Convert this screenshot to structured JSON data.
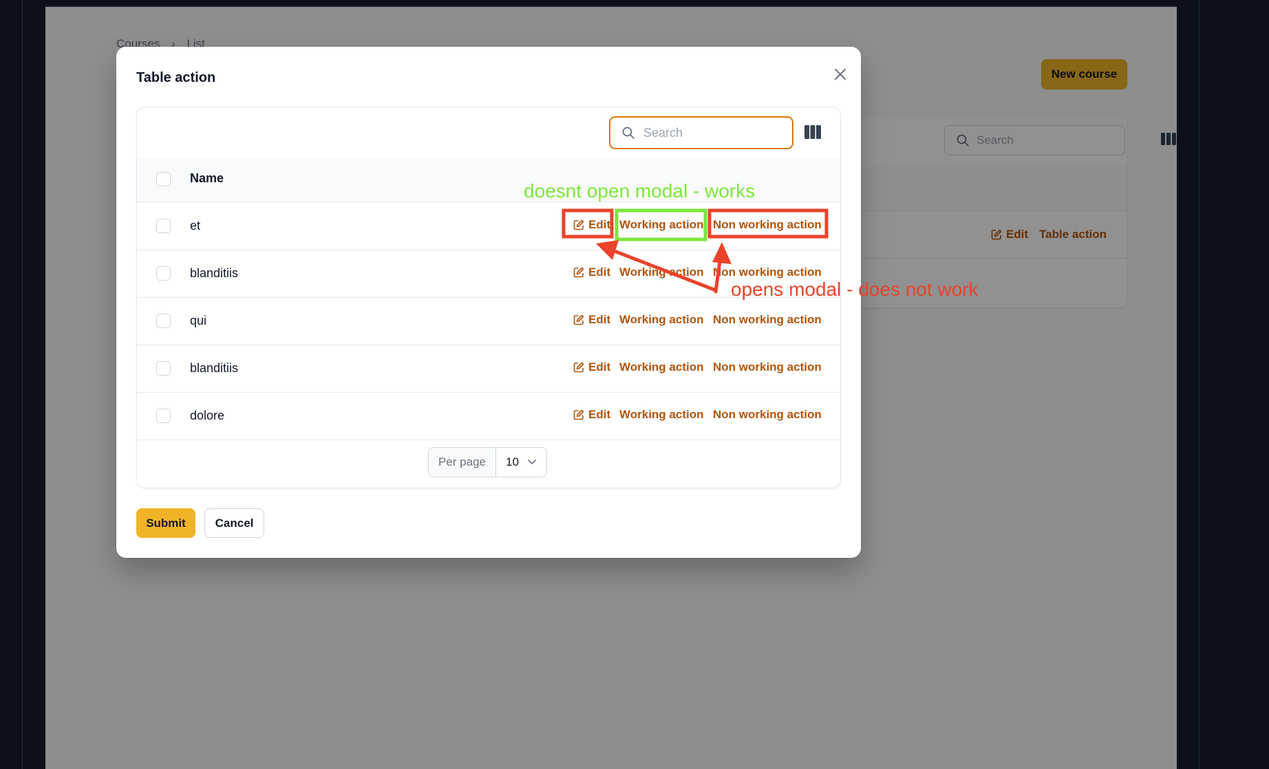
{
  "background_page": {
    "breadcrumb": [
      "Courses",
      "List"
    ],
    "new_course_label": "New course",
    "search_placeholder": "Search",
    "row_actions": [
      "Edit",
      "Table action"
    ]
  },
  "modal": {
    "title": "Table action",
    "search_placeholder": "Search",
    "search_value": "",
    "column_header": "Name",
    "rows": [
      {
        "name": "et"
      },
      {
        "name": "blanditiis"
      },
      {
        "name": "qui"
      },
      {
        "name": "blanditiis"
      },
      {
        "name": "dolore"
      }
    ],
    "actions": {
      "edit": "Edit",
      "working": "Working action",
      "non_working": "Non working action"
    },
    "pagination": {
      "per_page_label": "Per page",
      "per_page_value": "10"
    },
    "submit_label": "Submit",
    "cancel_label": "Cancel"
  },
  "annotations": {
    "green_note": "doesnt open modal - works",
    "red_note": "opens modal - does not work"
  },
  "colors": {
    "accent": "#f0b429",
    "action_text": "#b45309",
    "focus_border": "#d97706",
    "annotation_green": "#7ce63b",
    "annotation_red": "#e9432b"
  },
  "icons": [
    "search-icon",
    "columns-icon",
    "close-icon",
    "edit-icon",
    "chevron-down-icon",
    "chevron-right-icon"
  ]
}
